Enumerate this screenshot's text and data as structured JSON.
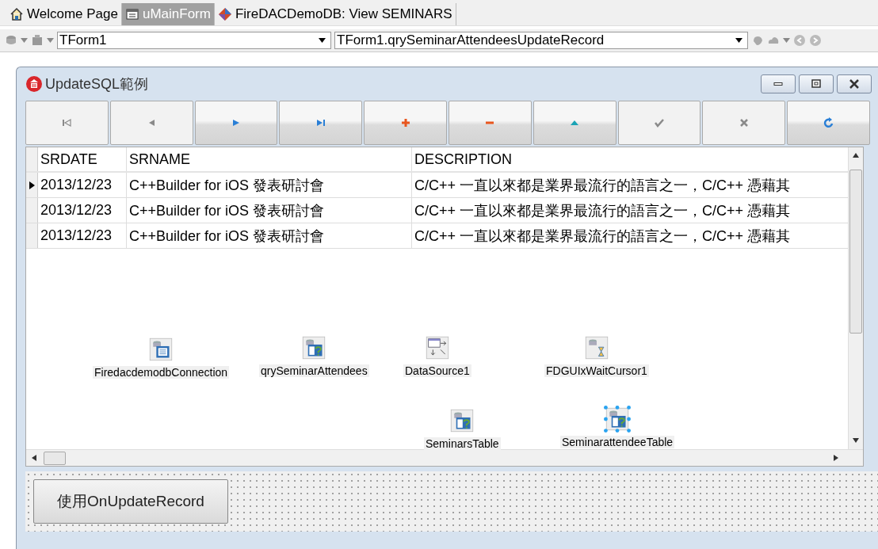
{
  "tabs": [
    {
      "label": "Welcome Page",
      "selected": false
    },
    {
      "label": "uMainForm",
      "selected": true
    },
    {
      "label": "FireDACDemoDB: View SEMINARS",
      "selected": false
    }
  ],
  "toolbar": {
    "object_combo": "TForm1",
    "method_combo": "TForm1.qrySeminarAttendeesUpdateRecord"
  },
  "form": {
    "title": "UpdateSQL範例",
    "navigator": [
      {
        "kind": "first",
        "disabled": true
      },
      {
        "kind": "prior",
        "disabled": true
      },
      {
        "kind": "next",
        "disabled": false
      },
      {
        "kind": "last",
        "disabled": false
      },
      {
        "kind": "insert",
        "disabled": false
      },
      {
        "kind": "delete",
        "disabled": false
      },
      {
        "kind": "edit",
        "disabled": false
      },
      {
        "kind": "post",
        "disabled": true
      },
      {
        "kind": "cancel",
        "disabled": true
      },
      {
        "kind": "refresh",
        "disabled": false
      }
    ],
    "grid": {
      "columns": [
        "SRDATE",
        "SRNAME",
        "DESCRIPTION"
      ],
      "rows": [
        {
          "current": true,
          "cells": [
            "2013/12/23",
            "C++Builder for iOS 發表研討會",
            "C/C++ 一直以來都是業界最流行的語言之一，C/C++ 憑藉其"
          ]
        },
        {
          "current": false,
          "cells": [
            "2013/12/23",
            "C++Builder for iOS 發表研討會",
            "C/C++ 一直以來都是業界最流行的語言之一，C/C++ 憑藉其"
          ]
        },
        {
          "current": false,
          "cells": [
            "2013/12/23",
            "C++Builder for iOS 發表研討會",
            "C/C++ 一直以來都是業界最流行的語言之一，C/C++ 憑藉其"
          ]
        }
      ]
    },
    "components": [
      {
        "kind": "connection",
        "name": "FiredacdemodbConnection",
        "selected": false
      },
      {
        "kind": "query",
        "name": "qrySeminarAttendees",
        "selected": false
      },
      {
        "kind": "datasource",
        "name": "DataSource1",
        "selected": false
      },
      {
        "kind": "waitcursor",
        "name": "FDGUIxWaitCursor1",
        "selected": false
      },
      {
        "kind": "query",
        "name": "SeminarsTable",
        "selected": false
      },
      {
        "kind": "query",
        "name": "SeminarattendeeTable",
        "selected": true
      }
    ],
    "button": "使用OnUpdateRecord"
  }
}
